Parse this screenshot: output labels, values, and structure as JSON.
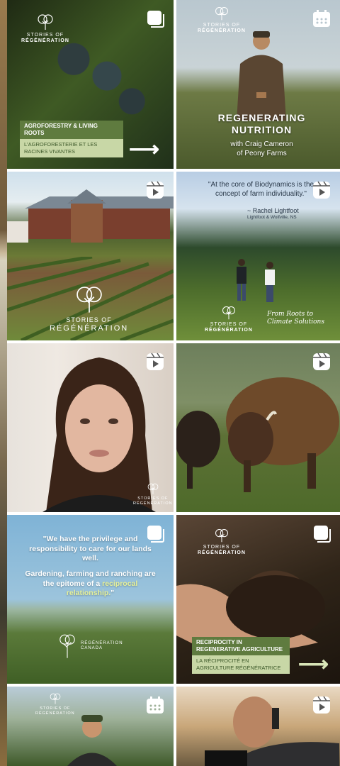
{
  "brand": {
    "name_line1": "STORIES OF",
    "name_line2": "RÉGÉNÉRATION",
    "canada_line1": "RÉGÉNÉRATION",
    "canada_line2": "CANADA"
  },
  "posts": [
    {
      "type": "carousel",
      "tag": "AGROFORESTRY & LIVING ROOTS",
      "subtag": "L'AGROFORESTERIE ET LES RACINES VIVANTES"
    },
    {
      "type": "event",
      "title_line1": "REGENERATING",
      "title_line2": "NUTRITION",
      "subtitle_line1": "with Craig Cameron",
      "subtitle_line2": "of Peony Farms"
    },
    {
      "type": "reel"
    },
    {
      "type": "reel",
      "quote": "\"At the core of Biodynamics is the concept of farm individuality.\"",
      "attribution": "~ Rachel Lightfoot",
      "attribution_sub": "Lightfoot & Wolfville, NS",
      "signature_line1": "From Roots to",
      "signature_line2": "Climate Solutions"
    },
    {
      "type": "reel"
    },
    {
      "type": "reel"
    },
    {
      "type": "carousel",
      "quote_part1": "\"We have the privilege and responsibility to care for our lands well.",
      "quote_part2": "Gardening, farming and ranching are the epitome of a",
      "quote_highlight": "reciprocal relationship.",
      "quote_end": "\""
    },
    {
      "type": "carousel",
      "tag": "RECIPROCITY IN REGENERATIVE AGRICULTURE",
      "subtag": "LA RÉCIPROCITÉ EN AGRICULTURE RÉGÉNÉRATRICE"
    },
    {
      "type": "event"
    },
    {
      "type": "reel"
    }
  ],
  "icons": {
    "carousel": "carousel-icon",
    "reel": "reel-icon",
    "event": "calendar-icon",
    "arrow": "arrow-right-icon",
    "brand": "regeneration-tree-icon"
  },
  "colors": {
    "tag_green": "#5f7b3f",
    "tag_light": "#c8d7a6",
    "highlight": "#e6f19a"
  }
}
